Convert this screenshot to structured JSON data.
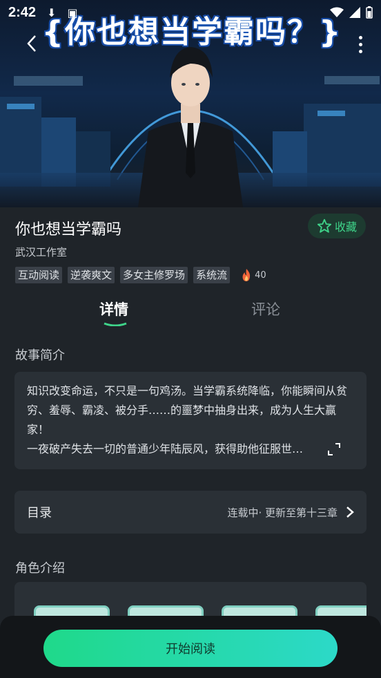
{
  "status_bar": {
    "time": "2:42"
  },
  "banner": {
    "title": "{你也想当学霸吗？}"
  },
  "book": {
    "title": "你也想当学霸吗",
    "favorite_label": "收藏",
    "author": "武汉工作室",
    "tags": [
      "互动阅读",
      "逆袭爽文",
      "多女主修罗场",
      "系统流"
    ],
    "heat": "40"
  },
  "tabs": [
    {
      "label": "详情"
    },
    {
      "label": "评论"
    }
  ],
  "synopsis": {
    "heading": "故事简介",
    "text": "知识改变命运，不只是一句鸡汤。当学霸系统降临，你能瞬间从贫穷、羞辱、霸凌、被分手……的噩梦中抽身出来，成为人生大赢家！\n一夜破产失去一切的普通少年陆辰风，获得助他征服世…"
  },
  "toc": {
    "label": "目录",
    "status": "连载中· 更新至第十三章"
  },
  "roles": {
    "heading": "角色介绍"
  },
  "bottom": {
    "read_label": "开始阅读"
  },
  "colors": {
    "accent": "#3fd48a",
    "button_start": "#1fd98a",
    "button_end": "#2cd9c8",
    "background": "#1f2429"
  }
}
